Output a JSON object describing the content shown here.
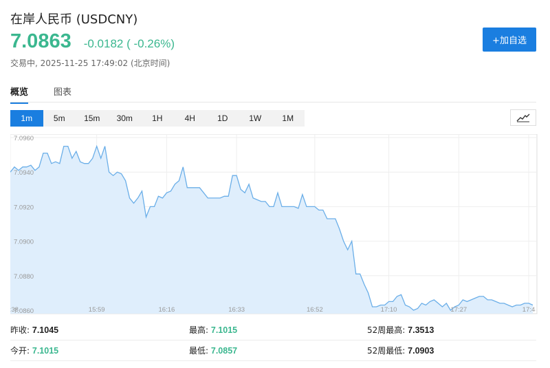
{
  "header": {
    "title": "在岸人民币  (USDCNY)",
    "price": "7.0863",
    "change": "-0.0182 ( -0.26%)",
    "status": "交易中",
    "separator": ",",
    "timestamp": "2025-11-25 17:49:02",
    "timezone": "(北京时间)",
    "add_button": "+加自选"
  },
  "tabs": [
    {
      "label": "概览",
      "active": true
    },
    {
      "label": "图表",
      "active": false
    }
  ],
  "ranges": [
    {
      "label": "1m",
      "active": true
    },
    {
      "label": "5m",
      "active": false
    },
    {
      "label": "15m",
      "active": false
    },
    {
      "label": "30m",
      "active": false
    },
    {
      "label": "1H",
      "active": false
    },
    {
      "label": "4H",
      "active": false
    },
    {
      "label": "1D",
      "active": false
    },
    {
      "label": "1W",
      "active": false
    },
    {
      "label": "1M",
      "active": false
    }
  ],
  "chart_toggle_icon": "line-chart-icon",
  "colors": {
    "accent": "#1a7ee0",
    "down": "#3bb78f",
    "line": "#6aaee8",
    "fill": "#dfeefc"
  },
  "chart_data": {
    "type": "area",
    "ylim": [
      7.0858,
      7.0962
    ],
    "xlim": [
      0,
      128
    ],
    "y_ticks": [
      "7.0960",
      "7.0940",
      "7.0920",
      "7.0900",
      "7.0880",
      "7.0860"
    ],
    "y_tick_values": [
      7.096,
      7.094,
      7.092,
      7.09,
      7.088,
      7.086
    ],
    "x_ticks": [
      "15:38",
      "15:59",
      "16:16",
      "16:33",
      "16:52",
      "17:10",
      "17:27",
      "17:4"
    ],
    "x_tick_values": [
      0,
      21,
      38,
      55,
      74,
      92,
      109,
      126
    ],
    "grid": true,
    "x": [
      0,
      1,
      2,
      3,
      4,
      5,
      6,
      7,
      8,
      9,
      10,
      11,
      12,
      13,
      14,
      15,
      16,
      17,
      18,
      19,
      20,
      21,
      22,
      23,
      24,
      25,
      26,
      27,
      28,
      29,
      30,
      31,
      32,
      33,
      34,
      35,
      36,
      37,
      38,
      39,
      40,
      41,
      42,
      43,
      44,
      45,
      46,
      47,
      48,
      49,
      50,
      51,
      52,
      53,
      54,
      55,
      56,
      57,
      58,
      59,
      60,
      61,
      62,
      63,
      64,
      65,
      66,
      67,
      68,
      69,
      70,
      71,
      72,
      73,
      74,
      75,
      76,
      77,
      78,
      79,
      80,
      81,
      82,
      83,
      84,
      85,
      86,
      87,
      88,
      89,
      90,
      91,
      92,
      93,
      94,
      95,
      96,
      97,
      98,
      99,
      100,
      101,
      102,
      103,
      104,
      105,
      106,
      107,
      108,
      109,
      110,
      111,
      112,
      113,
      114,
      115,
      116,
      117,
      118,
      119,
      120,
      121,
      122,
      123,
      124,
      125,
      126,
      127
    ],
    "values": [
      7.094,
      7.0943,
      7.0941,
      7.0943,
      7.0943,
      7.0944,
      7.0941,
      7.0943,
      7.0951,
      7.0951,
      7.0945,
      7.0946,
      7.0945,
      7.0955,
      7.0955,
      7.0948,
      7.0952,
      7.0946,
      7.0945,
      7.0945,
      7.0948,
      7.0955,
      7.0948,
      7.0955,
      7.094,
      7.0938,
      7.094,
      7.0939,
      7.0935,
      7.0925,
      7.0922,
      7.0925,
      7.0929,
      7.0914,
      7.092,
      7.092,
      7.0926,
      7.0925,
      7.0928,
      7.0929,
      7.0933,
      7.0935,
      7.0943,
      7.0931,
      7.0931,
      7.0931,
      7.0931,
      7.0928,
      7.0925,
      7.0925,
      7.0925,
      7.0925,
      7.0926,
      7.0926,
      7.0938,
      7.0938,
      7.093,
      7.0928,
      7.0933,
      7.0925,
      7.0924,
      7.0923,
      7.0923,
      7.092,
      7.092,
      7.0928,
      7.092,
      7.092,
      7.092,
      7.092,
      7.0919,
      7.0927,
      7.092,
      7.092,
      7.092,
      7.0918,
      7.0918,
      7.0913,
      7.0913,
      7.0913,
      7.0907,
      7.09,
      7.0895,
      7.09,
      7.0881,
      7.0881,
      7.0875,
      7.087,
      7.0862,
      7.0862,
      7.0863,
      7.0863,
      7.0865,
      7.0865,
      7.0868,
      7.0869,
      7.0863,
      7.0862,
      7.086,
      7.0861,
      7.0864,
      7.0863,
      7.0865,
      7.0866,
      7.0864,
      7.0862,
      7.0864,
      7.086,
      7.0862,
      7.0863,
      7.0866,
      7.0865,
      7.0866,
      7.0867,
      7.0868,
      7.0868,
      7.0866,
      7.0866,
      7.0865,
      7.0864,
      7.0864,
      7.0863,
      7.0862,
      7.0863,
      7.0863,
      7.0864,
      7.0864,
      7.0863
    ]
  },
  "stats": {
    "rows": [
      [
        {
          "label": "昨收:",
          "value": "7.1045",
          "green": false
        },
        {
          "label": "最高:",
          "value": "7.1015",
          "green": true
        },
        {
          "label": "52周最高:",
          "value": "7.3513",
          "green": false
        }
      ],
      [
        {
          "label": "今开:",
          "value": "7.1015",
          "green": true
        },
        {
          "label": "最低:",
          "value": "7.0857",
          "green": true
        },
        {
          "label": "52周最低:",
          "value": "7.0903",
          "green": false
        }
      ]
    ]
  }
}
